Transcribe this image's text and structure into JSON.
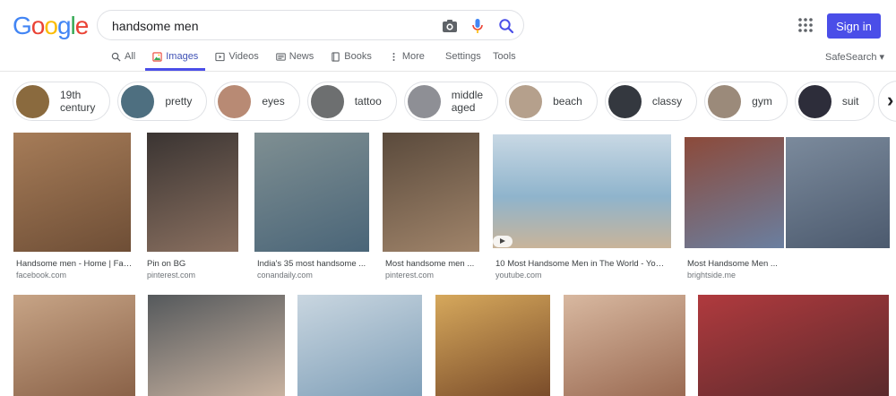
{
  "header": {
    "logo_letters": [
      {
        "ch": "G",
        "color": "#4285F4"
      },
      {
        "ch": "o",
        "color": "#EA4335"
      },
      {
        "ch": "o",
        "color": "#FBBC05"
      },
      {
        "ch": "g",
        "color": "#4285F4"
      },
      {
        "ch": "l",
        "color": "#34A853"
      },
      {
        "ch": "e",
        "color": "#EA4335"
      }
    ],
    "query": "handsome men",
    "signin_label": "Sign in",
    "accent": "#4a4ee8"
  },
  "tabs": [
    {
      "label": "All",
      "icon": "search-icon"
    },
    {
      "label": "Images",
      "icon": "image-icon",
      "active": true
    },
    {
      "label": "Videos",
      "icon": "video-icon"
    },
    {
      "label": "News",
      "icon": "news-icon"
    },
    {
      "label": "Books",
      "icon": "book-icon"
    },
    {
      "label": "More",
      "icon": "more-vert-icon"
    }
  ],
  "tools": {
    "settings": "Settings",
    "tools": "Tools",
    "safesearch": "SafeSearch ▾"
  },
  "chips": [
    {
      "label": "19th century",
      "color": "#8a6a3e"
    },
    {
      "label": "pretty",
      "color": "#4e6f80"
    },
    {
      "label": "eyes",
      "color": "#b88a74"
    },
    {
      "label": "tattoo",
      "color": "#6d6f70"
    },
    {
      "label": "middle aged",
      "color": "#8e8f95"
    },
    {
      "label": "beach",
      "color": "#b5a08c"
    },
    {
      "label": "classy",
      "color": "#34383f"
    },
    {
      "label": "gym",
      "color": "#9b8a7a"
    },
    {
      "label": "suit",
      "color": "#2d2d3a"
    },
    {
      "label": "",
      "color": "#8a3e6e"
    }
  ],
  "results": [
    {
      "title": "Handsome men - Home | Fac...",
      "source": "facebook.com",
      "color": "#8e6a4c"
    },
    {
      "title": "Pin on BG",
      "source": "pinterest.com",
      "color": "#7a6658"
    },
    {
      "title": "India's 35 most handsome ...",
      "source": "conandaily.com",
      "color": "#5e7480"
    },
    {
      "title": "Most handsome men ...",
      "source": "pinterest.com",
      "color": "#8a7058"
    },
    {
      "title": "10 Most Handsome Men in The World - YouT...",
      "source": "youtube.com",
      "color": "#b8cbd6"
    },
    {
      "title": "Most Handsome Men ...",
      "source": "brightside.me",
      "color": "#6f7a8c"
    },
    {
      "title": "",
      "source": "",
      "color": "#a07e66"
    },
    {
      "title": "",
      "source": "",
      "color": "#7f8588"
    },
    {
      "title": "",
      "source": "",
      "color": "#a4b6c4"
    },
    {
      "title": "",
      "source": "",
      "color": "#b48a52"
    },
    {
      "title": "",
      "source": "",
      "color": "#b9907a"
    },
    {
      "title": "",
      "source": "",
      "color": "#9c3a3e"
    }
  ]
}
